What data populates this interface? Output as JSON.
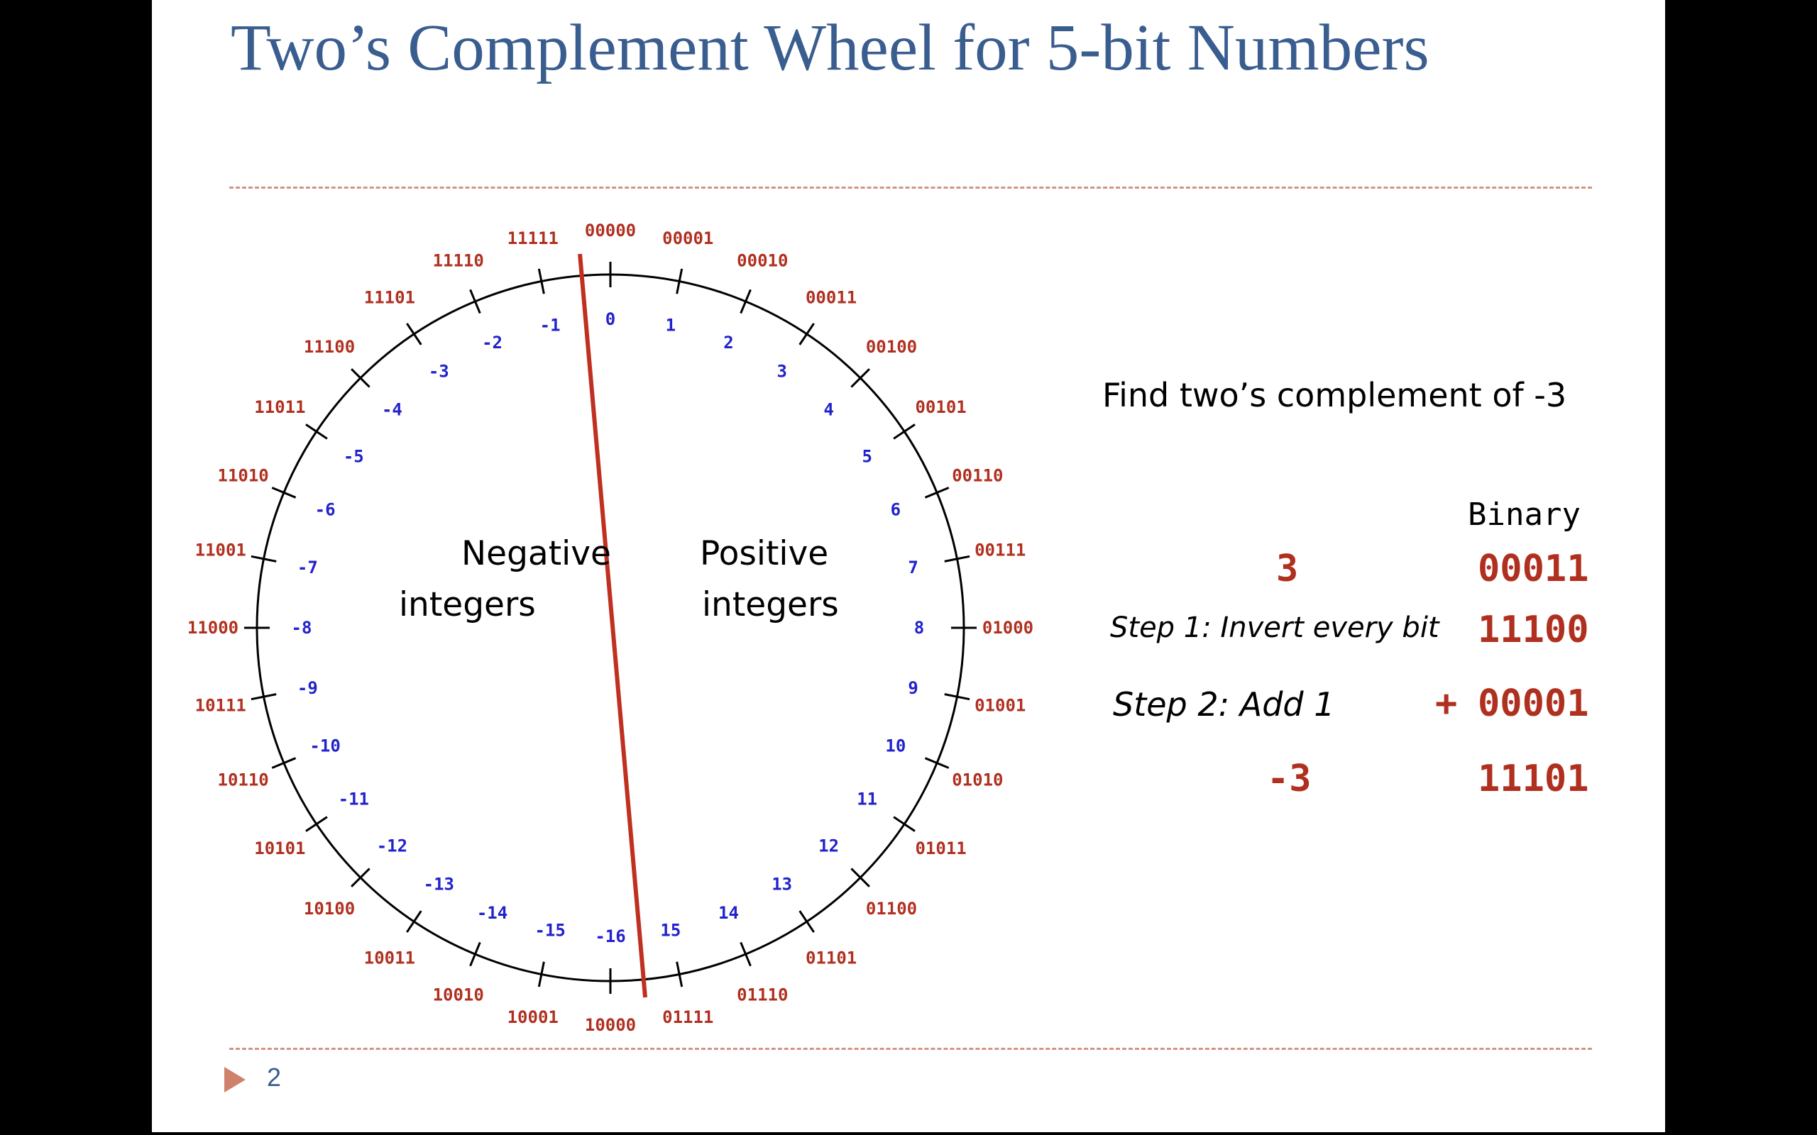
{
  "slide": {
    "title": "Two’s Complement Wheel for 5-bit Numbers",
    "page_number": "2",
    "footer_icon": "triangle-bullet-icon"
  },
  "colors": {
    "title": "#3a5d8f",
    "binary_labels": "#b03020",
    "decimal_labels": "#2222cc",
    "divider_line": "#c03020",
    "rules": "#d09585",
    "footer_arrow": "#d0816b"
  },
  "wheel": {
    "left_region_label": [
      "Negative",
      "integers"
    ],
    "right_region_label": [
      "Positive",
      "integers"
    ],
    "entries": [
      {
        "binary": "00000",
        "decimal": "0"
      },
      {
        "binary": "00001",
        "decimal": "1"
      },
      {
        "binary": "00010",
        "decimal": "2"
      },
      {
        "binary": "00011",
        "decimal": "3"
      },
      {
        "binary": "00100",
        "decimal": "4"
      },
      {
        "binary": "00101",
        "decimal": "5"
      },
      {
        "binary": "00110",
        "decimal": "6"
      },
      {
        "binary": "00111",
        "decimal": "7"
      },
      {
        "binary": "01000",
        "decimal": "8"
      },
      {
        "binary": "01001",
        "decimal": "9"
      },
      {
        "binary": "01010",
        "decimal": "10"
      },
      {
        "binary": "01011",
        "decimal": "11"
      },
      {
        "binary": "01100",
        "decimal": "12"
      },
      {
        "binary": "01101",
        "decimal": "13"
      },
      {
        "binary": "01110",
        "decimal": "14"
      },
      {
        "binary": "01111",
        "decimal": "15"
      },
      {
        "binary": "10000",
        "decimal": "-16"
      },
      {
        "binary": "10001",
        "decimal": "-15"
      },
      {
        "binary": "10010",
        "decimal": "-14"
      },
      {
        "binary": "10011",
        "decimal": "-13"
      },
      {
        "binary": "10100",
        "decimal": "-12"
      },
      {
        "binary": "10101",
        "decimal": "-11"
      },
      {
        "binary": "10110",
        "decimal": "-10"
      },
      {
        "binary": "10111",
        "decimal": "-9"
      },
      {
        "binary": "11000",
        "decimal": "-8"
      },
      {
        "binary": "11001",
        "decimal": "-7"
      },
      {
        "binary": "11010",
        "decimal": "-6"
      },
      {
        "binary": "11011",
        "decimal": "-5"
      },
      {
        "binary": "11100",
        "decimal": "-4"
      },
      {
        "binary": "11101",
        "decimal": "-3"
      },
      {
        "binary": "11110",
        "decimal": "-2"
      },
      {
        "binary": "11111",
        "decimal": "-1"
      }
    ]
  },
  "example": {
    "question": "Find two’s complement of -3",
    "column_header": "Binary",
    "start_decimal": "3",
    "start_binary": "00011",
    "step1_label": "Step 1: Invert every bit",
    "step1_binary": "11100",
    "step2_label": "Step 2: Add 1",
    "step2_operator": "+",
    "step2_binary": "00001",
    "result_decimal": "-3",
    "result_binary": "11101"
  }
}
